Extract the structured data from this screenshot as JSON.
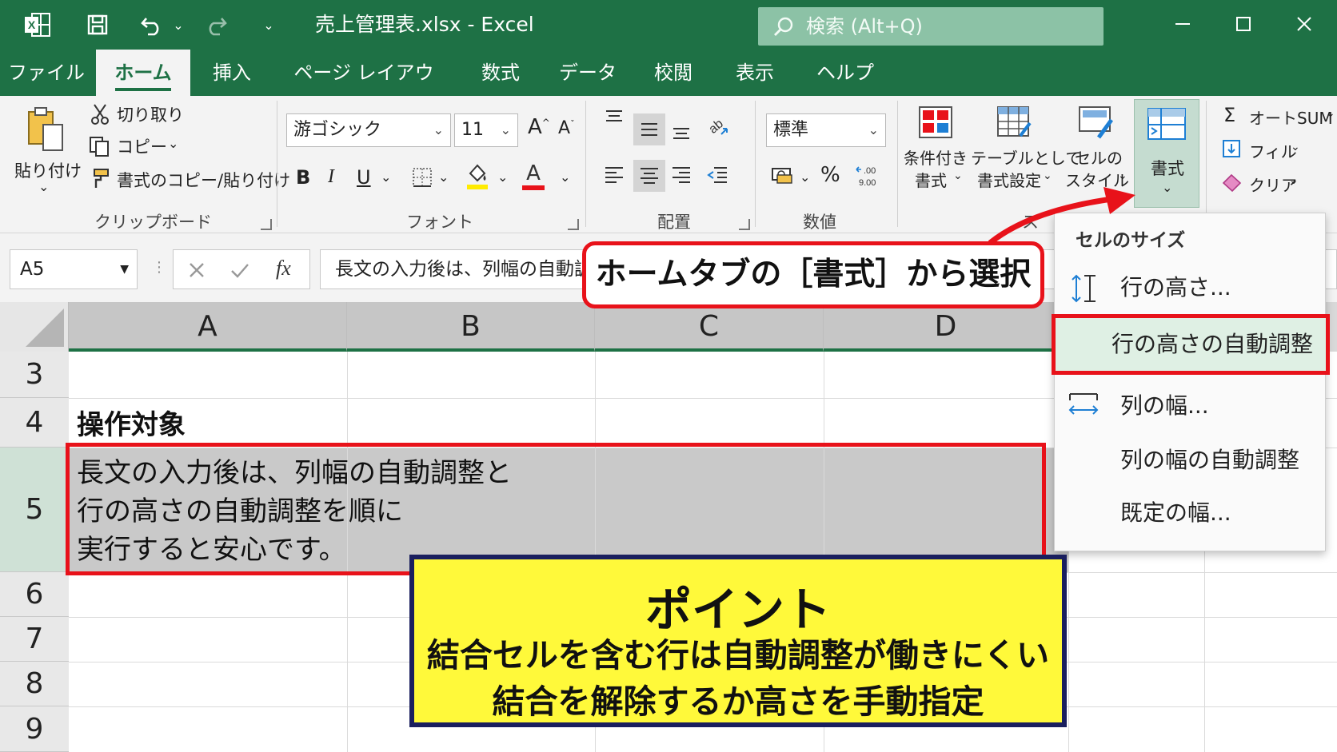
{
  "titlebar": {
    "file_title": "売上管理表.xlsx  -  Excel",
    "search_placeholder": "検索 (Alt+Q)"
  },
  "tabs": [
    {
      "label": "ファイル"
    },
    {
      "label": "ホーム",
      "active": true
    },
    {
      "label": "挿入"
    },
    {
      "label": "ページ レイアウト"
    },
    {
      "label": "数式"
    },
    {
      "label": "データ"
    },
    {
      "label": "校閲"
    },
    {
      "label": "表示"
    },
    {
      "label": "ヘルプ"
    }
  ],
  "ribbon": {
    "clipboard": {
      "paste": "貼り付け",
      "cut": "切り取り",
      "copy": "コピー",
      "format_painter": "書式のコピー/貼り付け",
      "group_label": "クリップボード"
    },
    "font": {
      "font_name": "游ゴシック",
      "font_size": "11",
      "group_label": "フォント",
      "bold": "B",
      "italic": "I",
      "underline": "U",
      "increase": "A",
      "decrease": "A",
      "font_color_letter": "A"
    },
    "alignment": {
      "group_label": "配置"
    },
    "number": {
      "format": "標準",
      "group_label": "数値",
      "percent": "%"
    },
    "styles": {
      "conditional_line1": "条件付き",
      "conditional_line2": "書式",
      "table_line1": "テーブルとして",
      "table_line2": "書式設定",
      "cell_line1": "セルの",
      "cell_line2": "スタイル",
      "group_label_fragment": "ス"
    },
    "cells": {
      "format_button": "書式"
    },
    "editing": {
      "autosum": "オートSUM",
      "fill": "フィル",
      "clear": "クリア"
    }
  },
  "formula_bar": {
    "name_box": "A5",
    "fx": "fx",
    "content": "長文の入力後は、列幅の自動調"
  },
  "sheet": {
    "columns": [
      "A",
      "B",
      "C",
      "D"
    ],
    "rows": [
      "3",
      "4",
      "5",
      "6",
      "7",
      "8",
      "9"
    ],
    "a4": "操作対象",
    "a5_line1": "長文の入力後は、列幅の自動調整と",
    "a5_line2": "行の高さの自動調整を順に",
    "a5_line3": "実行すると安心です。"
  },
  "format_menu": {
    "header": "セルのサイズ",
    "items": [
      {
        "label": "行の高さ..."
      },
      {
        "label": "行の高さの自動調整",
        "highlighted": true
      },
      {
        "label": "列の幅..."
      },
      {
        "label": "列の幅の自動調整"
      },
      {
        "label": "既定の幅..."
      }
    ]
  },
  "callout": {
    "text": "ホームタブの［書式］から選択"
  },
  "point_box": {
    "title": "ポイント",
    "line1": "結合セルを含む行は自動調整が働きにくい",
    "line2": "結合を解除するか高さを手動指定"
  },
  "colors": {
    "excel_green": "#1e7145",
    "highlight_red": "#e8121a",
    "point_yellow": "#fff93a",
    "point_border": "#1a1f5e"
  }
}
